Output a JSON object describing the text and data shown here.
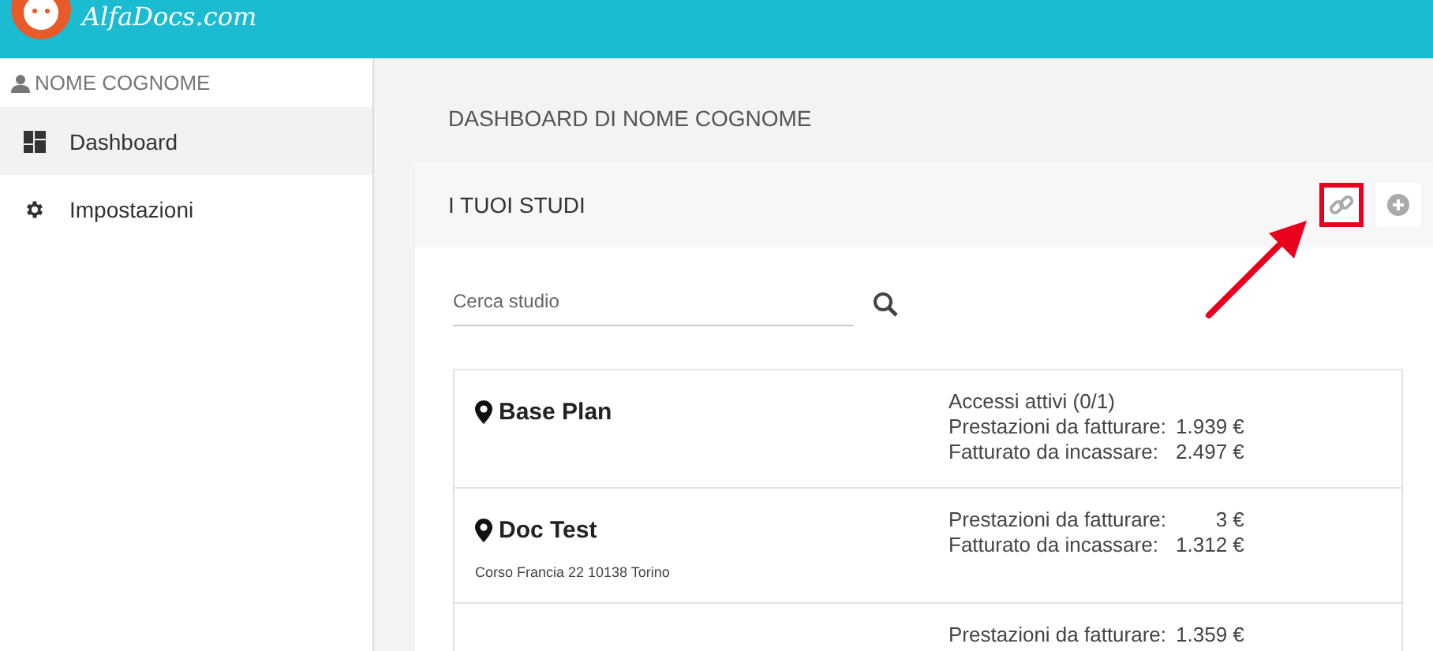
{
  "header": {
    "logo_text": "AlfaDocs.com"
  },
  "sidebar": {
    "user": "NOME COGNOME",
    "items": [
      {
        "label": "Dashboard",
        "kind": "dashboard",
        "selected": true
      },
      {
        "label": "Impostazioni",
        "kind": "settings",
        "selected": false
      }
    ]
  },
  "page_title": "DASHBOARD DI NOME COGNOME",
  "panel": {
    "title": "I TUOI STUDI",
    "actions": [
      {
        "kind": "link",
        "highlighted": true
      },
      {
        "kind": "add",
        "highlighted": false
      }
    ],
    "search": {
      "placeholder": "Cerca studio"
    },
    "studios": [
      {
        "name": "Base Plan",
        "stats": [
          {
            "kind": "text",
            "label": "Accessi attivi (0/1)"
          },
          {
            "kind": "stat",
            "label": "Prestazioni da fatturare:",
            "value": "1.939 €"
          },
          {
            "kind": "stat",
            "label": "Fatturato da incassare:",
            "value": "2.497 €"
          }
        ]
      },
      {
        "name": "Doc Test",
        "address": "Corso Francia 22 10138 Torino",
        "stats": [
          {
            "kind": "stat",
            "label": "Prestazioni da fatturare:",
            "value": "3 €"
          },
          {
            "kind": "stat",
            "label": "Fatturato da incassare:",
            "value": "1.312 €"
          }
        ]
      },
      {
        "stats": [
          {
            "kind": "stat",
            "label": "Prestazioni da fatturare:",
            "value": "1.359 €"
          }
        ]
      }
    ]
  }
}
